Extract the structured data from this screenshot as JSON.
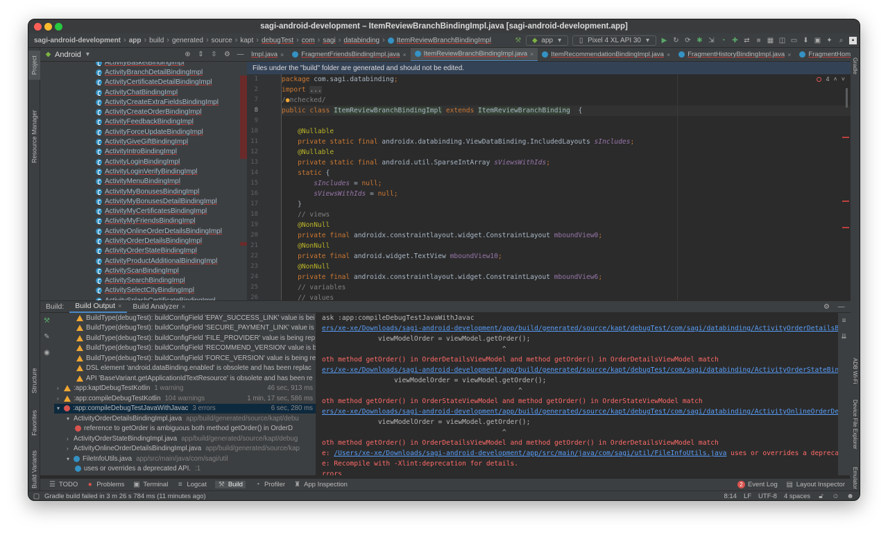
{
  "window": {
    "title": "sagi-android-development – ItemReviewBranchBindingImpl.java [sagi-android-development.app]"
  },
  "navbar": {
    "breadcrumbs": [
      "sagi-android-development",
      "app",
      "build",
      "generated",
      "source",
      "kapt",
      "debugTest",
      "com",
      "sagi",
      "databinding",
      "ItemReviewBranchBindingImpl"
    ],
    "run_config": "app",
    "device": "Pixel 4 XL API 30"
  },
  "left_strip": {
    "project": "Project",
    "resource_manager": "Resource Manager",
    "structure": "Structure",
    "favorites": "Favorites",
    "build_variants": "Build Variants"
  },
  "right_strip": {
    "gradle": "Gradle",
    "adb_wifi": "ADB Wi-Fi",
    "device_file_explorer": "Device File Explorer",
    "emulator": "Emulator"
  },
  "project_panel": {
    "view": "Android",
    "items": [
      "ActivityBasketBindingImpl",
      "ActivityBranchDetailBindingImpl",
      "ActivityCertificateDetailBindingImpl",
      "ActivityChatBindingImpl",
      "ActivityCreateExtraFieldsBindingImpl",
      "ActivityCreateOrderBindingImpl",
      "ActivityFeedbackBindingImpl",
      "ActivityForceUpdateBindingImpl",
      "ActivityGiveGiftBindingImpl",
      "ActivityIntroBindingImpl",
      "ActivityLoginBindingImpl",
      "ActivityLoginVerifyBindingImpl",
      "ActivityMenuBindingImpl",
      "ActivityMyBonusesBindingImpl",
      "ActivityMyBonusesDetailBindingImpl",
      "ActivityMyCertificatesBindingImpl",
      "ActivityMyFriendsBindingImpl",
      "ActivityOnlineOrderDetailsBindingImpl",
      "ActivityOrderDetailsBindingImpl",
      "ActivityOrderStateBindingImpl",
      "ActivityProductAdditionalBindingImpl",
      "ActivityScanBindingImpl",
      "ActivitySearchBindingImpl",
      "ActivitySelectCityBindingImpl",
      "ActivitySplashCertificateBindingImpl"
    ]
  },
  "tabs": [
    {
      "label": "Impl.java",
      "active": false
    },
    {
      "label": "FragmentFriendsBindingImpl.java",
      "active": false
    },
    {
      "label": "ItemReviewBranchBindingImpl.java",
      "active": true
    },
    {
      "label": "ItemRecommendationBindingImpl.java",
      "active": false
    },
    {
      "label": "FragmentHistoryBindingImpl.java",
      "active": false
    },
    {
      "label": "FragmentHomeBindingImpl.java",
      "active": false
    }
  ],
  "editor": {
    "banner": "Files under the \"build\" folder are generated and should not be edited.",
    "error_count": "4",
    "line_numbers": [
      "1",
      "2",
      "7",
      "8",
      "9",
      "10",
      "11",
      "12",
      "13",
      "14",
      "15",
      "16",
      "17",
      "18",
      "19",
      "20",
      "21",
      "22",
      "23",
      "24",
      "25",
      "26"
    ],
    "current_line": "8"
  },
  "build": {
    "label": "Build:",
    "tabs": [
      "Build Output",
      "Build Analyzer"
    ],
    "tree": [
      {
        "kind": "warn",
        "indent": 1,
        "text": "BuildType(debugTest): buildConfigField 'EPAY_SUCCESS_LINK' value is bei"
      },
      {
        "kind": "warn",
        "indent": 1,
        "text": "BuildType(debugTest): buildConfigField 'SECURE_PAYMENT_LINK' value is l"
      },
      {
        "kind": "warn",
        "indent": 1,
        "text": "BuildType(debugTest): buildConfigField 'FILE_PROVIDER' value is being rep"
      },
      {
        "kind": "warn",
        "indent": 1,
        "text": "BuildType(debugTest): buildConfigField 'RECOMMEND_VERSION' value is be"
      },
      {
        "kind": "warn",
        "indent": 1,
        "text": "BuildType(debugTest): buildConfigField 'FORCE_VERSION' value is being re"
      },
      {
        "kind": "warn",
        "indent": 1,
        "text": "DSL element 'android.dataBinding.enabled' is obsolete and has been replac"
      },
      {
        "kind": "warn",
        "indent": 1,
        "text": "API 'BaseVariant.getApplicationIdTextResource' is obsolete and has been re"
      },
      {
        "kind": "warn",
        "indent": 0,
        "arrow": ">",
        "text": ":app:kaptDebugTestKotlin",
        "gray": "1 warning",
        "time": "46 sec, 913 ms"
      },
      {
        "kind": "warn",
        "indent": 0,
        "arrow": ">",
        "text": ":app:compileDebugTestKotlin",
        "gray": "104 warnings",
        "time": "1 min, 17 sec, 586 ms"
      },
      {
        "kind": "err",
        "indent": 0,
        "arrow": "v",
        "text": ":app:compileDebugTestJavaWithJavac",
        "gray": "3 errors",
        "time": "6 sec, 280 ms",
        "sel": true
      },
      {
        "kind": "none",
        "indent": 1,
        "arrow": "v",
        "text": "ActivityOrderDetailsBindingImpl.java",
        "gray": "app/build/generated/source/kapt/debu"
      },
      {
        "kind": "err",
        "indent": 2,
        "text": "reference to getOrder is ambiguous both method getOrder() in OrderD"
      },
      {
        "kind": "none",
        "indent": 1,
        "arrow": ">",
        "text": "ActivityOrderStateBindingImpl.java",
        "gray": "app/build/generated/source/kapt/debug"
      },
      {
        "kind": "none",
        "indent": 1,
        "arrow": ">",
        "text": "ActivityOnlineOrderDetailsBindingImpl.java",
        "gray": "app/build/generated/source/kap"
      },
      {
        "kind": "none",
        "indent": 1,
        "arrow": "v",
        "text": "FileInfoUtils.java",
        "gray": "app/src/main/java/com/sagi/util"
      },
      {
        "kind": "info",
        "indent": 2,
        "text": "uses or overrides a deprecated API.",
        "gray": ":1"
      }
    ],
    "console": [
      {
        "c": "",
        "t": "ask :app:compileDebugTestJavaWithJavac"
      },
      {
        "c": "link",
        "t": "ers/xe-xe/Downloads/sagi-android-development/app/build/generated/source/kapt/debugTest/com/sagi/databinding/ActivityOrderDetailsBi"
      },
      {
        "c": "",
        "t": "              viewModelOrder = viewModel.getOrder();"
      },
      {
        "c": "",
        "t": "                                             ^"
      },
      {
        "c": "red",
        "t": "oth method getOrder() in OrderDetailsViewModel and method getOrder() in OrderDetailsViewModel match"
      },
      {
        "c": "link",
        "t": "ers/xe-xe/Downloads/sagi-android-development/app/build/generated/source/kapt/debugTest/com/sagi/databinding/ActivityOrderStateBind"
      },
      {
        "c": "",
        "t": "                  viewModelOrder = viewModel.getOrder();"
      },
      {
        "c": "",
        "t": "                                                 ^"
      },
      {
        "c": "red",
        "t": "oth method getOrder() in OrderStateViewModel and method getOrder() in OrderStateViewModel match"
      },
      {
        "c": "link",
        "t": "ers/xe-xe/Downloads/sagi-android-development/app/build/generated/source/kapt/debugTest/com/sagi/databinding/ActivityOnlineOrderDet"
      },
      {
        "c": "",
        "t": "              viewModelOrder = viewModel.getOrder();"
      },
      {
        "c": "",
        "t": "                                             ^"
      },
      {
        "c": "red",
        "t": "oth method getOrder() in OrderDetailsViewModel and method getOrder() in OrderDetailsViewModel match"
      },
      {
        "c": "mix",
        "t": "e: ",
        "l": "/Users/xe-xe/Downloads/sagi-android-development/app/src/main/java/com/sagi/util/FileInfoUtils.java",
        "r": " uses or overrides a deprecat"
      },
      {
        "c": "red",
        "t": "e: Recompile with -Xlint:deprecation for details."
      },
      {
        "c": "red",
        "t": "rrors"
      }
    ]
  },
  "bottom_tools": [
    "TODO",
    "Problems",
    "Terminal",
    "Logcat",
    "Build",
    "Profiler",
    "App Inspection"
  ],
  "bottom_right": {
    "event_log": "Event Log",
    "event_count": "2",
    "layout_inspector": "Layout Inspector"
  },
  "status": {
    "message": "Gradle build failed in 3 m 26 s 784 ms (11 minutes ago)",
    "position": "8:14",
    "line_sep": "LF",
    "encoding": "UTF-8",
    "indent": "4 spaces"
  },
  "colors": {
    "accent": "#4a88c7",
    "error": "#d9534f",
    "warning": "#f0a732",
    "link": "#589df6"
  }
}
